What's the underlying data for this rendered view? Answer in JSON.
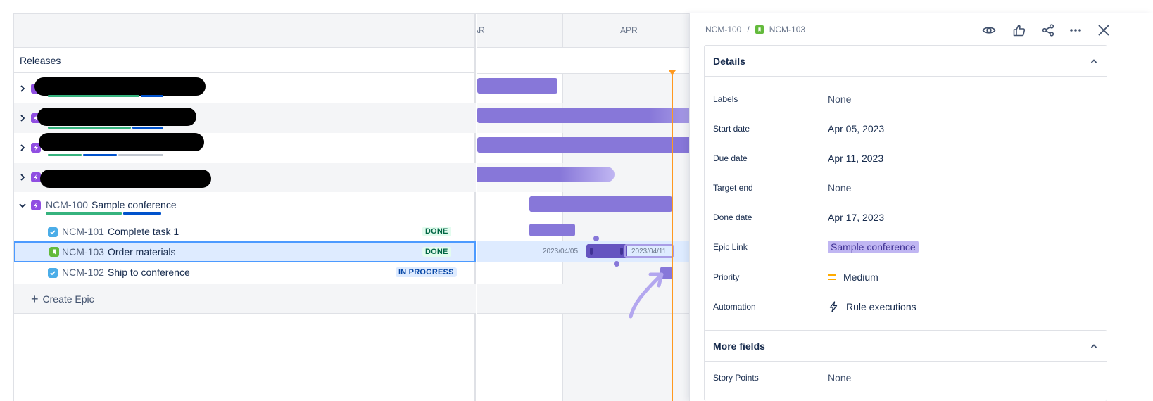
{
  "list": {
    "releases_label": "Releases",
    "create_epic_label": "Create Epic",
    "create_epic_icon": "plus-icon"
  },
  "epics": [
    {
      "state": "collapsed",
      "redacted": true
    },
    {
      "state": "collapsed",
      "redacted": true
    },
    {
      "state": "collapsed",
      "redacted": true
    },
    {
      "state": "collapsed",
      "redacted": true
    },
    {
      "state": "expanded",
      "key": "NCM-100",
      "summary": "Sample conference",
      "children": [
        {
          "key": "NCM-101",
          "summary": "Complete task 1",
          "type": "task",
          "status": "DONE"
        },
        {
          "key": "NCM-103",
          "summary": "Order materials",
          "type": "story",
          "status": "DONE",
          "selected": true
        },
        {
          "key": "NCM-102",
          "summary": "Ship to conference",
          "type": "task",
          "status": "IN PROGRESS"
        }
      ]
    }
  ],
  "timeline": {
    "months": [
      "AR",
      "APR"
    ],
    "selected_start_label": "2023/04/05",
    "selected_end_label": "2023/04/11"
  },
  "detail": {
    "breadcrumb_parent": "NCM-100",
    "breadcrumb_separator": "/",
    "breadcrumb_current": "NCM-103",
    "actions": [
      "eye-icon",
      "like-icon",
      "share-icon",
      "more-icon",
      "close-icon"
    ],
    "details_title": "Details",
    "fields": {
      "labels": {
        "label": "Labels",
        "value": "None"
      },
      "start_date": {
        "label": "Start date",
        "value": "Apr 05, 2023"
      },
      "due_date": {
        "label": "Due date",
        "value": "Apr 11, 2023"
      },
      "target_end": {
        "label": "Target end",
        "value": "None"
      },
      "done_date": {
        "label": "Done date",
        "value": "Apr 17, 2023"
      },
      "epic_link": {
        "label": "Epic Link",
        "value": "Sample conference"
      },
      "priority": {
        "label": "Priority",
        "value": "Medium"
      },
      "automation": {
        "label": "Automation",
        "value": "Rule executions"
      }
    },
    "more_fields_title": "More fields",
    "story_points": {
      "label": "Story Points",
      "value": "None"
    }
  },
  "colors": {
    "epic": "#904ee2",
    "bar": "#8777d9",
    "today_line": "#ff991f",
    "selection": "#deebff",
    "done_bg": "#e3fcef",
    "in_progress_bg": "#deebff"
  }
}
